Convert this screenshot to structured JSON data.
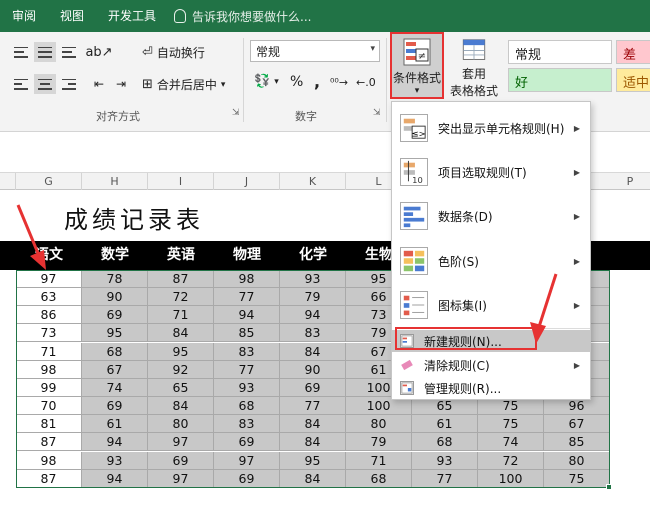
{
  "menubar": {
    "items": [
      "审阅",
      "视图",
      "开发工具"
    ],
    "tell_me": "告诉我你想要做什么..."
  },
  "ribbon": {
    "wrap_text": "自动换行",
    "merge_center": "合并后居中",
    "align_group": "对齐方式",
    "number_format": "常规",
    "percent": "%",
    "comma": ",",
    "number_group": "数字",
    "conditional_format": "条件格式",
    "table_format_1": "套用",
    "table_format_2": "表格格式",
    "styles": {
      "normal": "常规",
      "bad": "差",
      "good": "好",
      "neutral": "适中"
    }
  },
  "sheet": {
    "columns": [
      "G",
      "H",
      "I",
      "J",
      "K",
      "L",
      "P"
    ],
    "title": "成绩记录表",
    "headers": [
      "语文",
      "数学",
      "英语",
      "物理",
      "化学",
      "生物"
    ],
    "rows": [
      [
        "97",
        "78",
        "87",
        "98",
        "93",
        "95",
        "",
        ""
      ],
      [
        "63",
        "90",
        "72",
        "77",
        "79",
        "66",
        "",
        ""
      ],
      [
        "86",
        "69",
        "71",
        "94",
        "94",
        "73",
        "",
        ""
      ],
      [
        "73",
        "95",
        "84",
        "85",
        "83",
        "79",
        "",
        ""
      ],
      [
        "71",
        "68",
        "95",
        "83",
        "84",
        "67",
        "",
        ""
      ],
      [
        "98",
        "67",
        "92",
        "77",
        "90",
        "61",
        "",
        ""
      ],
      [
        "99",
        "74",
        "65",
        "93",
        "69",
        "100",
        "",
        ""
      ],
      [
        "70",
        "69",
        "84",
        "68",
        "77",
        "100",
        "65",
        "75",
        "96"
      ],
      [
        "81",
        "61",
        "80",
        "83",
        "84",
        "80",
        "61",
        "75",
        "67"
      ],
      [
        "87",
        "94",
        "97",
        "69",
        "84",
        "79",
        "68",
        "74",
        "85"
      ],
      [
        "98",
        "93",
        "69",
        "97",
        "95",
        "71",
        "93",
        "72",
        "80"
      ],
      [
        "87",
        "94",
        "97",
        "69",
        "84",
        "68",
        "77",
        "100",
        "75"
      ]
    ]
  },
  "dropdown": {
    "items": [
      {
        "label": "突出显示单元格规则(H)",
        "arrow": "▶"
      },
      {
        "label": "项目选取规则(T)",
        "arrow": "▶"
      },
      {
        "label": "数据条(D)",
        "arrow": "▶"
      },
      {
        "label": "色阶(S)",
        "arrow": "▶"
      },
      {
        "label": "图标集(I)",
        "arrow": "▶"
      }
    ],
    "new_rule": "新建规则(N)...",
    "clear_rule": "清除规则(C)",
    "manage_rule": "管理规则(R)..."
  },
  "colors": {
    "accent": "#217346",
    "highlight": "#e63232"
  }
}
